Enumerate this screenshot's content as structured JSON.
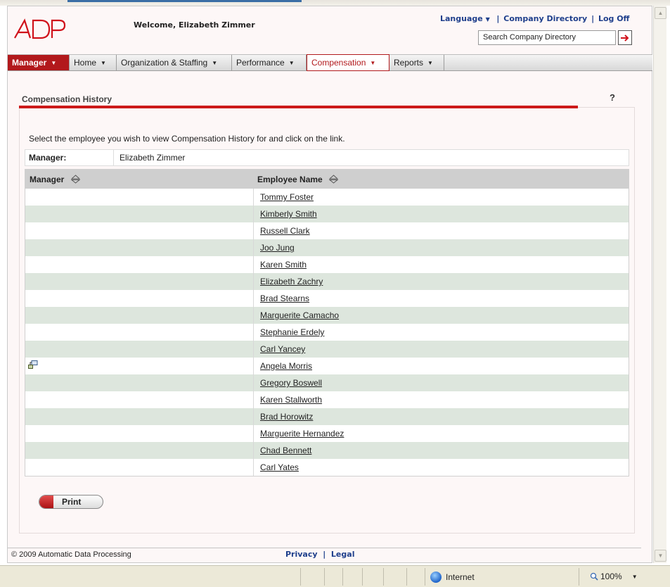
{
  "header": {
    "welcome": "Welcome, Elizabeth Zimmer",
    "language_label": "Language",
    "company_directory_label": "Company Directory",
    "log_off_label": "Log Off",
    "search_placeholder": "Search Company Directory"
  },
  "nav": {
    "manager": "Manager",
    "home": "Home",
    "org_staffing": "Organization & Staffing",
    "performance": "Performance",
    "compensation": "Compensation",
    "reports": "Reports"
  },
  "page": {
    "title": "Compensation History",
    "help": "?",
    "instructions": "Select the employee you wish to view Compensation History for and click on the link.",
    "manager_label": "Manager:",
    "manager_value": "Elizabeth Zimmer"
  },
  "grid": {
    "columns": [
      "Manager",
      "Employee Name"
    ],
    "rows": [
      {
        "employee": "Tommy Foster"
      },
      {
        "employee": "Kimberly Smith"
      },
      {
        "employee": "Russell Clark"
      },
      {
        "employee": "Joo Jung"
      },
      {
        "employee": "Karen Smith"
      },
      {
        "employee": "Elizabeth Zachry"
      },
      {
        "employee": "Brad Stearns"
      },
      {
        "employee": "Marguerite Camacho"
      },
      {
        "employee": "Stephanie Erdely"
      },
      {
        "employee": "Carl Yancey"
      },
      {
        "employee": "Angela Morris",
        "manager_icon": "org-chart-icon"
      },
      {
        "employee": "Gregory Boswell"
      },
      {
        "employee": "Karen Stallworth"
      },
      {
        "employee": "Brad Horowitz"
      },
      {
        "employee": "Marguerite Hernandez"
      },
      {
        "employee": "Chad Bennett"
      },
      {
        "employee": "Carl Yates"
      }
    ]
  },
  "actions": {
    "print": "Print"
  },
  "footer": {
    "copyright": "© 2009 Automatic Data Processing",
    "privacy": "Privacy",
    "legal": "Legal"
  },
  "status_bar": {
    "zone": "Internet",
    "zoom": "100%"
  },
  "colors": {
    "brand_red": "#b2191c",
    "link_blue": "#1f3f8c",
    "row_alt": "#dde6dd",
    "grid_header": "#cfcfcf"
  }
}
